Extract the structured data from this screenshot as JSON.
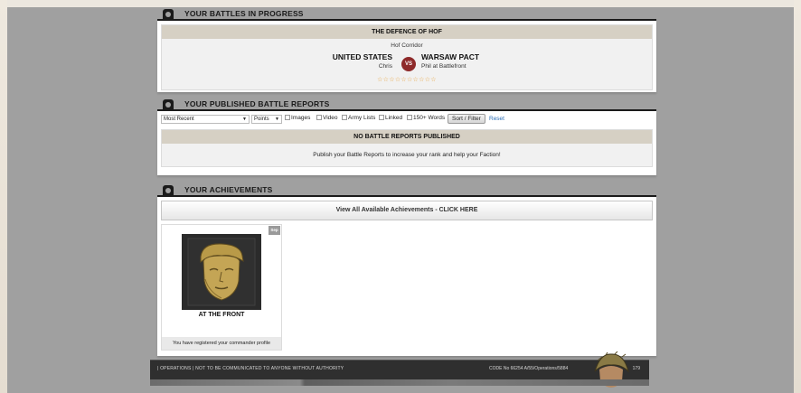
{
  "battles": {
    "section_title": "YOUR BATTLES IN PROGRESS",
    "battle_title": "THE DEFENCE OF HOF",
    "location": "Hof Corridor",
    "team_a": {
      "name": "UNITED STATES",
      "player": "Chris"
    },
    "vs_label": "VS",
    "team_b": {
      "name": "WARSAW PACT",
      "player": "Phil at Battlefront"
    },
    "rating_stars": "☆☆☆☆☆☆☆☆☆☆"
  },
  "reports": {
    "section_title": "YOUR PUBLISHED BATTLE REPORTS",
    "sort_select": "Most Recent",
    "points_select": "Points",
    "filters": [
      "Images",
      "Video",
      "Army Lists",
      "Linked",
      "150+ Words"
    ],
    "filter_button": "Sort / Filter",
    "reset_link": "Reset",
    "empty_title": "NO BATTLE REPORTS PUBLISHED",
    "empty_message": "Publish your Battle Reports to increase your rank and help your Faction!"
  },
  "achievements": {
    "section_title": "YOUR ACHIEVEMENTS",
    "cta": "View All Available Achievements - CLICK HERE",
    "card": {
      "tag": "Sep",
      "title": "AT THE FRONT",
      "description": "You have registered your commander profile"
    }
  },
  "footer": {
    "left_text": "| OPERATIONS | NOT TO BE COMMUNICATED TO ANYONE WITHOUT AUTHORITY",
    "code": "CODE No 66254 A/55/Operations/5884",
    "page": "179"
  },
  "colors": {
    "stage_bg": "#a0a0a0",
    "bar_bg": "#d6d0c4",
    "vs_badge": "#8e2a2a",
    "star": "#e8a33c",
    "link": "#2a6db5"
  },
  "icons": [
    "section-knob-icon",
    "dropdown-arrow-icon",
    "checkbox-icon",
    "soldier-portrait-icon"
  ]
}
